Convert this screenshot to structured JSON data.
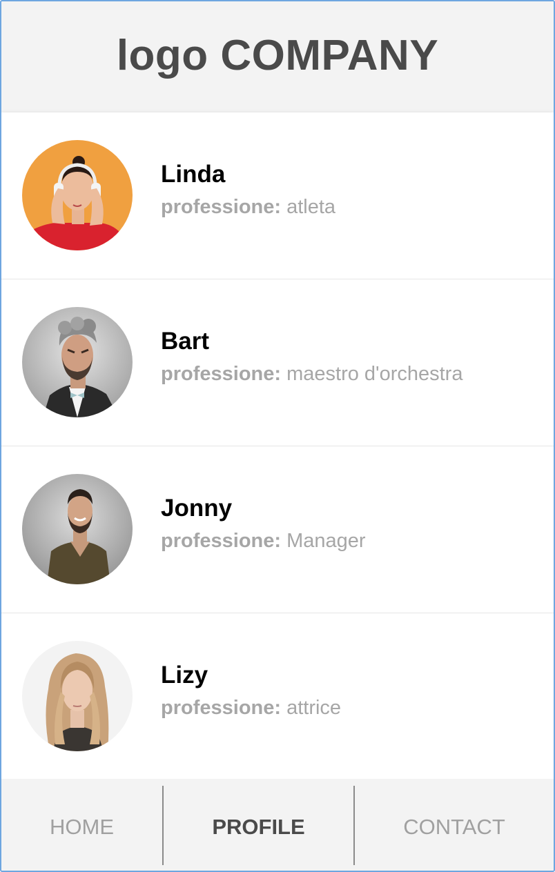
{
  "header": {
    "title": "logo COMPANY"
  },
  "profiles": [
    {
      "name": "Linda",
      "label": "professione:",
      "profession": "atleta"
    },
    {
      "name": "Bart",
      "label": "professione:",
      "profession": "maestro d'orchestra"
    },
    {
      "name": "Jonny",
      "label": "professione:",
      "profession": "Manager"
    },
    {
      "name": "Lizy",
      "label": "professione:",
      "profession": "attrice"
    }
  ],
  "tabs": {
    "home": "HOME",
    "profile": "PROFILE",
    "contact": "CONTACT"
  },
  "colors": {
    "header_bg": "#f3f3f3",
    "title": "#4a4a4a",
    "muted": "#a6a6a6",
    "frame_border": "#6ea6e0"
  }
}
